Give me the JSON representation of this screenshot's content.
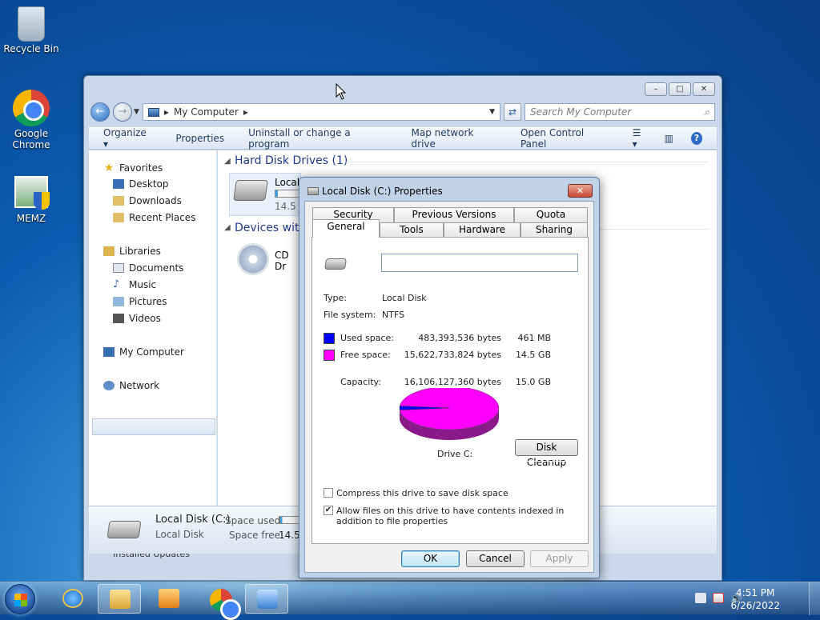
{
  "desktop": {
    "icons": [
      {
        "label": "Recycle Bin"
      },
      {
        "label": "Google Chrome"
      },
      {
        "label": "MEMZ"
      }
    ]
  },
  "explorer": {
    "address": "My Computer",
    "search_placeholder": "Search My Computer",
    "commands": [
      "Organize",
      "Properties",
      "Uninstall or change a program",
      "Map network drive",
      "Open Control Panel"
    ],
    "nav": {
      "favorites": "Favorites",
      "desktop": "Desktop",
      "downloads": "Downloads",
      "recent": "Recent Places",
      "libraries": "Libraries",
      "documents": "Documents",
      "music": "Music",
      "pictures": "Pictures",
      "videos": "Videos",
      "computer": "My Computer",
      "network": "Network"
    },
    "groups": {
      "hdd": "Hard Disk Drives (1)",
      "removable": "Devices with"
    },
    "items": {
      "local_disk_name": "Local",
      "local_disk_free": "14.5",
      "cd_name": "CD Dr"
    },
    "details": {
      "name": "Local Disk (C:)",
      "type": "Local Disk",
      "space_used_label": "Space used:",
      "space_free_label": "Space free:",
      "space_free_value": "14.5 G"
    },
    "behind_text": "Installed Updates"
  },
  "dialog": {
    "title": "Local Disk (C:) Properties",
    "tabs_back": [
      "Security",
      "Previous Versions",
      "Quota"
    ],
    "tabs_front": [
      "General",
      "Tools",
      "Hardware",
      "Sharing"
    ],
    "active_tab": "General",
    "name_value": "",
    "type_label": "Type:",
    "type_value": "Local Disk",
    "fs_label": "File system:",
    "fs_value": "NTFS",
    "used_label": "Used space:",
    "used_bytes": "483,393,536 bytes",
    "used_human": "461 MB",
    "free_label": "Free space:",
    "free_bytes": "15,622,733,824 bytes",
    "free_human": "14.5 GB",
    "capacity_label": "Capacity:",
    "capacity_bytes": "16,106,127,360 bytes",
    "capacity_human": "15.0 GB",
    "drive_label": "Drive C:",
    "cleanup_button": "Disk Cleanup",
    "compress_label": "Compress this drive to save disk space",
    "compress_checked": false,
    "index_label": "Allow files on this drive to have contents indexed in addition to file properties",
    "index_checked": true,
    "ok": "OK",
    "cancel": "Cancel",
    "apply": "Apply",
    "colors": {
      "used": "#0000ff",
      "free": "#ff00ff"
    },
    "pie_used_fraction": 0.03
  },
  "taskbar": {
    "time": "4:51 PM",
    "date": "6/26/2022"
  }
}
